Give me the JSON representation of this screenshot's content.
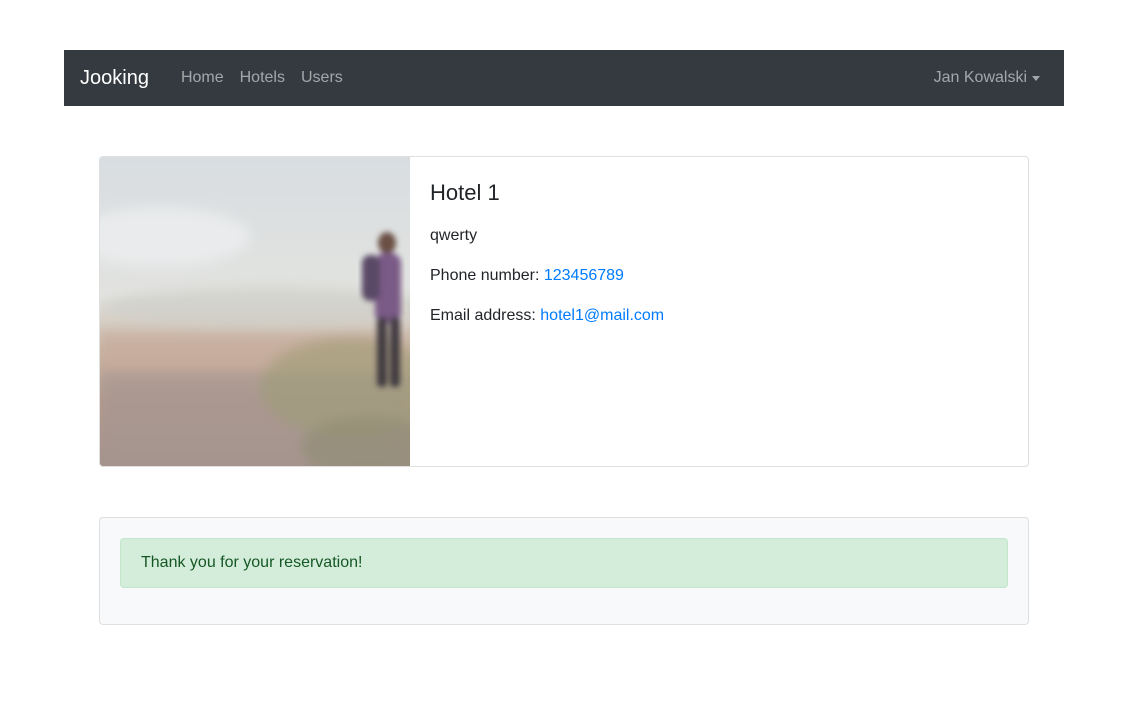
{
  "navbar": {
    "brand": "Jooking",
    "links": [
      "Home",
      "Hotels",
      "Users"
    ],
    "user": "Jan Kowalski"
  },
  "hotel": {
    "name": "Hotel 1",
    "description": "qwerty",
    "phone_label": "Phone number:",
    "phone": "123456789",
    "email_label": "Email address:",
    "email": "hotel1@mail.com"
  },
  "reservation": {
    "message": "Thank you for your reservation!"
  },
  "colors": {
    "navbar_bg": "#343a40",
    "link": "#007bff",
    "alert_bg": "#d4edda",
    "alert_text": "#155724"
  }
}
